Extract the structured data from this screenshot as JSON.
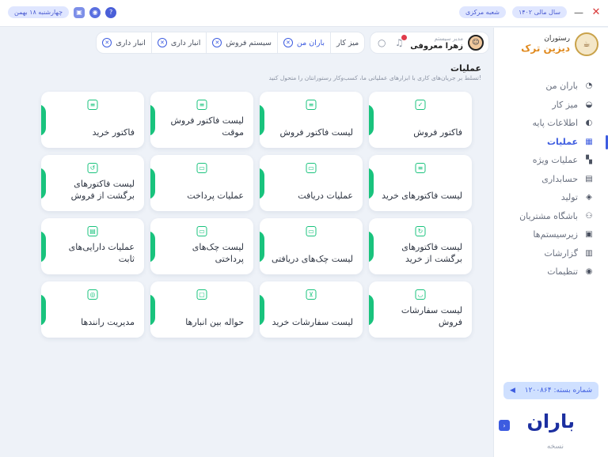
{
  "titlebar": {
    "fiscal_year": "سال مالی ۱۴۰۲",
    "branch": "شعبه مرکزی",
    "date": "چهارشنبه ۱۸ بهمن",
    "minimize": "—",
    "close": "✕"
  },
  "sidebar": {
    "logo_small": "رستوران",
    "logo_big": "دیزین ترک",
    "items": [
      {
        "label": "باران من",
        "icon": "baran-icon",
        "glyph": "◔"
      },
      {
        "label": "میز کار",
        "icon": "desk-icon",
        "glyph": "◒"
      },
      {
        "label": "اطلاعات پایه",
        "icon": "info-icon",
        "glyph": "◐"
      },
      {
        "label": "عملیات",
        "icon": "grid-icon",
        "glyph": "▦",
        "active": true
      },
      {
        "label": "عملیات ویژه",
        "icon": "special-ops-icon",
        "glyph": "▚"
      },
      {
        "label": "حسابداری",
        "icon": "calculator-icon",
        "glyph": "▤"
      },
      {
        "label": "تولید",
        "icon": "box-icon",
        "glyph": "◈"
      },
      {
        "label": "باشگاه مشتریان",
        "icon": "users-icon",
        "glyph": "⚇"
      },
      {
        "label": "زیرسیستم‌ها",
        "icon": "subsystem-icon",
        "glyph": "▣"
      },
      {
        "label": "گزارشات",
        "icon": "chart-icon",
        "glyph": "▥"
      },
      {
        "label": "تنظیمات",
        "icon": "settings-icon",
        "glyph": "◉"
      }
    ],
    "branch_label": "شماره بسته: ۱۲۰۰۸۶۴",
    "brand": "باران",
    "version": "نسخه"
  },
  "header": {
    "user_role": "مدیر سیستم",
    "user_name": "زهرا معروفی",
    "tabs": [
      {
        "label": "میز کار",
        "active": false,
        "closable": false
      },
      {
        "label": "باران من",
        "active": true
      },
      {
        "label": "سیستم فروش",
        "active": false
      },
      {
        "label": "انبار داری",
        "active": false
      },
      {
        "label": "انبار داری",
        "active": false
      }
    ]
  },
  "page": {
    "title": "عملیات",
    "subtitle": "تسلط بر جریان‌های کاری با ابزارهای عملیاتی ما، کسب‌وکار رستورانتان را متحول کنید!"
  },
  "cards": [
    {
      "label": "فاکتور فروش",
      "icon": "invoice-icon",
      "glyph": "✓"
    },
    {
      "label": "لیست فاکتور فروش",
      "icon": "list-icon",
      "glyph": "≡"
    },
    {
      "label": "لیست فاکتور فروش موقت",
      "icon": "temp-list-icon",
      "glyph": "≡"
    },
    {
      "label": "فاکتور خرید",
      "icon": "purchase-icon",
      "glyph": "≡"
    },
    {
      "label": "لیست فاکتورهای خرید",
      "icon": "purchase-list-icon",
      "glyph": "≡"
    },
    {
      "label": "عملیات دریافت",
      "icon": "receive-icon",
      "glyph": "▭"
    },
    {
      "label": "عملیات پرداخت",
      "icon": "payment-icon",
      "glyph": "▭"
    },
    {
      "label": "لیست فاکتورهای برگشت از فروش",
      "icon": "sales-return-icon",
      "glyph": "↺"
    },
    {
      "label": "لیست فاکتورهای برگشت از خرید",
      "icon": "purchase-return-icon",
      "glyph": "↻"
    },
    {
      "label": "لیست چک‌های دریافتی",
      "icon": "cheque-in-icon",
      "glyph": "▭"
    },
    {
      "label": "لیست چک‌های پرداختی",
      "icon": "cheque-out-icon",
      "glyph": "▭"
    },
    {
      "label": "عملیات دارایی‌های ثابت",
      "icon": "asset-icon",
      "glyph": "▤"
    },
    {
      "label": "لیست سفارشات فروش",
      "icon": "basket-icon",
      "glyph": "◡"
    },
    {
      "label": "لیست سفارشات خرید",
      "icon": "cart-icon",
      "glyph": "⊻"
    },
    {
      "label": "حواله بین انبارها",
      "icon": "transfer-icon",
      "glyph": "▢"
    },
    {
      "label": "مدیریت رانندها",
      "icon": "driver-icon",
      "glyph": "◎"
    }
  ],
  "colors": {
    "accent": "#3d5ce0",
    "green": "#19c37d",
    "brand": "#1c2fa0"
  }
}
